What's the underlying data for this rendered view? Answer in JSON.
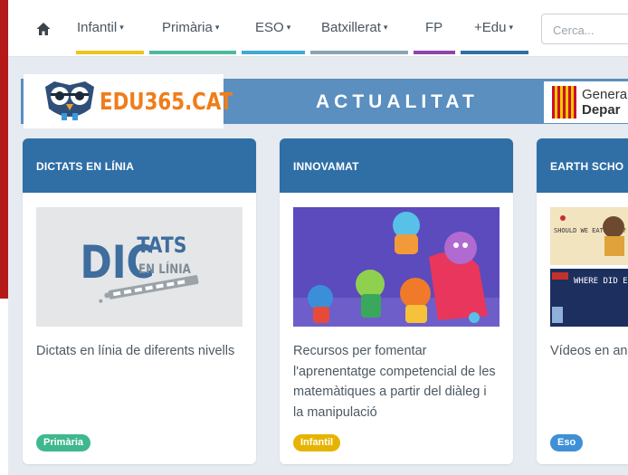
{
  "navbar": {
    "items": [
      {
        "label": "Infantil",
        "has_menu": true,
        "color": "#f0c419"
      },
      {
        "label": "Primària",
        "has_menu": true,
        "color": "#4fb99f"
      },
      {
        "label": "ESO",
        "has_menu": true,
        "color": "#3fa9d6"
      },
      {
        "label": "Batxillerat",
        "has_menu": true,
        "color": "#8aa4b2"
      },
      {
        "label": "FP",
        "has_menu": false,
        "color": "#8e44ad"
      },
      {
        "label": "+Edu",
        "has_menu": true,
        "color": "#2f6fa6"
      }
    ],
    "caret": "▾",
    "search_placeholder": "Cerca..."
  },
  "banner": {
    "logo_text": "EDU365.CAT",
    "title": "ACTUALITAT",
    "generalitat_line1": "Genera",
    "generalitat_line2": "Depar"
  },
  "cards": [
    {
      "header": "DICTATS EN LÍNIA",
      "image_text_main": "DIC",
      "image_text_top": "TATS",
      "image_text_bottom": "EN LÍNIA",
      "description": "Dictats en línia de diferents nivells",
      "tag": "Primària",
      "tag_color": "#3fb88e"
    },
    {
      "header": "INNOVAMAT",
      "description": "Recursos per fomentar l'aprenentatge competencial de les matemàtiques a partir del diàleg i la manipulació",
      "tag": "Infantil",
      "tag_color": "#e6b400"
    },
    {
      "header": "EARTH SCHO",
      "image_text_1": "SHOULD WE EAT BUGS?",
      "image_text_2": "WHERE DID EARTH WATE COME FRO",
      "description": "Vídeos en an immersió nat",
      "tag": "Eso",
      "tag_color": "#3f8fd6"
    }
  ],
  "colors": {
    "accent_red": "#b51a1a",
    "banner_blue": "#5a8fc0",
    "card_header_blue": "#2f6fa6",
    "logo_orange": "#f07d1a"
  }
}
